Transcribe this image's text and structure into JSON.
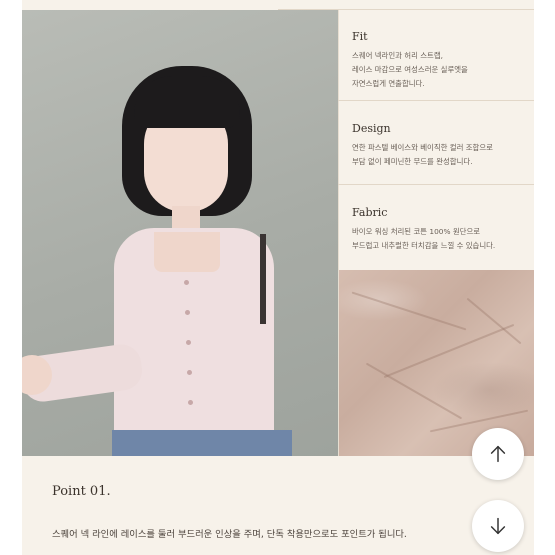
{
  "sections": [
    {
      "title": "Fit",
      "lines": [
        "스퀘어 넥라인과 허리 스트랩,",
        "레이스 마감으로 여성스러운 실루엣을",
        "자연스럽게 연출합니다."
      ]
    },
    {
      "title": "Design",
      "lines": [
        "연한 파스텔 베이스와 베이직한 컬러 조합으로",
        "부담 없이 페미닌한 무드를 완성합니다."
      ]
    },
    {
      "title": "Fabric",
      "lines": [
        "바이오 워싱 처리된 코튼 100% 원단으로",
        "부드럽고 내추럴한 터치감을 느낄 수 있습니다."
      ]
    }
  ],
  "point": {
    "title": "Point 01.",
    "text": "스퀘어 넥 라인에 레이스를 둘러 부드러운 인상을 주며, 단독 착용만으로도 포인트가 됩니다."
  },
  "icons": {
    "scroll_up": "arrow-up-icon",
    "scroll_down": "arrow-down-icon"
  },
  "colors": {
    "panel_bg": "#f7f2ea",
    "fabric": "#d0b5a8",
    "text": "#3b332c"
  }
}
